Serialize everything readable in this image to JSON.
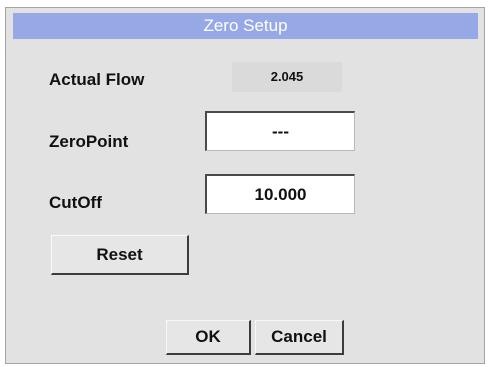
{
  "dialog": {
    "title": "Zero Setup"
  },
  "actual_flow": {
    "label": "Actual Flow",
    "value": "2.045"
  },
  "zero_point": {
    "label": "ZeroPoint",
    "value": "---"
  },
  "cutoff": {
    "label": "CutOff",
    "value": "10.000"
  },
  "buttons": {
    "reset": "Reset",
    "ok": "OK",
    "cancel": "Cancel"
  },
  "colors": {
    "title_bar": "#96a9e6",
    "panel": "#e2e2e2"
  }
}
